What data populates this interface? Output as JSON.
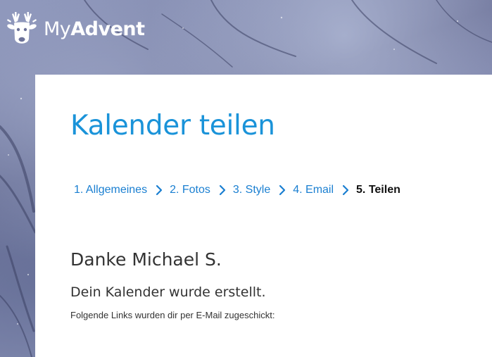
{
  "header": {
    "logo_icon": "reindeer-icon",
    "brand_light": "My",
    "brand_bold": "Advent"
  },
  "main": {
    "title": "Kalender teilen",
    "steps": [
      {
        "label": "1. Allgemeines",
        "active": false
      },
      {
        "label": "2. Fotos",
        "active": false
      },
      {
        "label": "3. Style",
        "active": false
      },
      {
        "label": "4. Email",
        "active": false
      },
      {
        "label": "5. Teilen",
        "active": true
      }
    ],
    "step_separator_icon": "chevron-right-icon",
    "thanks_text": "Danke Michael S.",
    "created_text": "Dein Kalender wurde erstellt.",
    "info_text": "Folgende Links wurden dir per E-Mail zugeschickt:"
  },
  "colors": {
    "accent": "#1a93d9",
    "link": "#1a7fd1",
    "text": "#333333",
    "card": "#ffffff"
  }
}
